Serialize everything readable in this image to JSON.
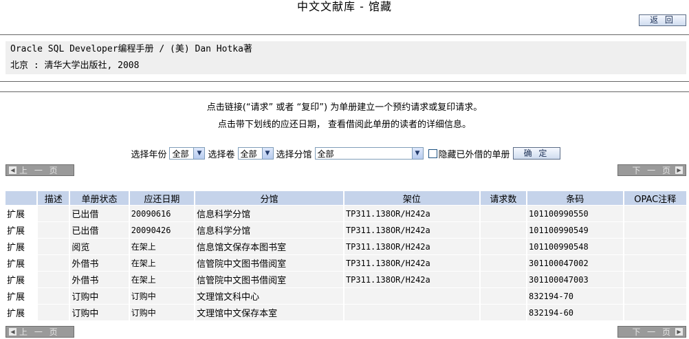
{
  "page": {
    "title": "中文文献库 - 馆藏",
    "return_label": "返 回"
  },
  "bib": {
    "line1": "Oracle SQL Developer编程手册 / (美) Dan Hotka著",
    "line2": "北京 : 清华大学出版社, 2008"
  },
  "notes": {
    "line1": "点击链接(“请求” 或者 “复印”) 为单册建立一个预约请求或复印请求。",
    "line2": "点击带下划线的应还日期， 查看借阅此单册的读者的详细信息。"
  },
  "filters": {
    "year_label": "选择年份",
    "year_value": "全部",
    "volume_label": "选择卷",
    "volume_value": "全部",
    "branch_label": "选择分馆",
    "branch_value": "全部",
    "hide_label": "隐藏已外借的单册",
    "confirm_label": "确 定"
  },
  "pager": {
    "prev_label": "上 一 页",
    "next_label": "下 一 页"
  },
  "table": {
    "headers": [
      "",
      "描述",
      "单册状态",
      "应还日期",
      "分馆",
      "架位",
      "请求数",
      "条码",
      "OPAC注释"
    ],
    "rows": [
      [
        "扩展",
        "",
        "已出借",
        "20090616",
        "信息科学分馆",
        "TP311.138OR/H242a",
        "",
        "101100990550",
        ""
      ],
      [
        "扩展",
        "",
        "已出借",
        "20090426",
        "信息科学分馆",
        "TP311.138OR/H242a",
        "",
        "101100990549",
        ""
      ],
      [
        "扩展",
        "",
        "阅览",
        "在架上",
        "信息馆文保存本图书室",
        "TP311.138OR/H242a",
        "",
        "101100990548",
        ""
      ],
      [
        "扩展",
        "",
        "外借书",
        "在架上",
        "信管院中文图书借阅室",
        "TP311.138OR/H242a",
        "",
        "301100047002",
        ""
      ],
      [
        "扩展",
        "",
        "外借书",
        "在架上",
        "信管院中文图书借阅室",
        "TP311.138OR/H242a",
        "",
        "301100047003",
        ""
      ],
      [
        "扩展",
        "",
        "订购中",
        "订购中",
        "文理馆文科中心",
        "",
        "",
        "832194-70",
        ""
      ],
      [
        "扩展",
        "",
        "订购中",
        "订购中",
        "文理馆中文保存本室",
        "",
        "",
        "832194-60",
        ""
      ]
    ]
  }
}
